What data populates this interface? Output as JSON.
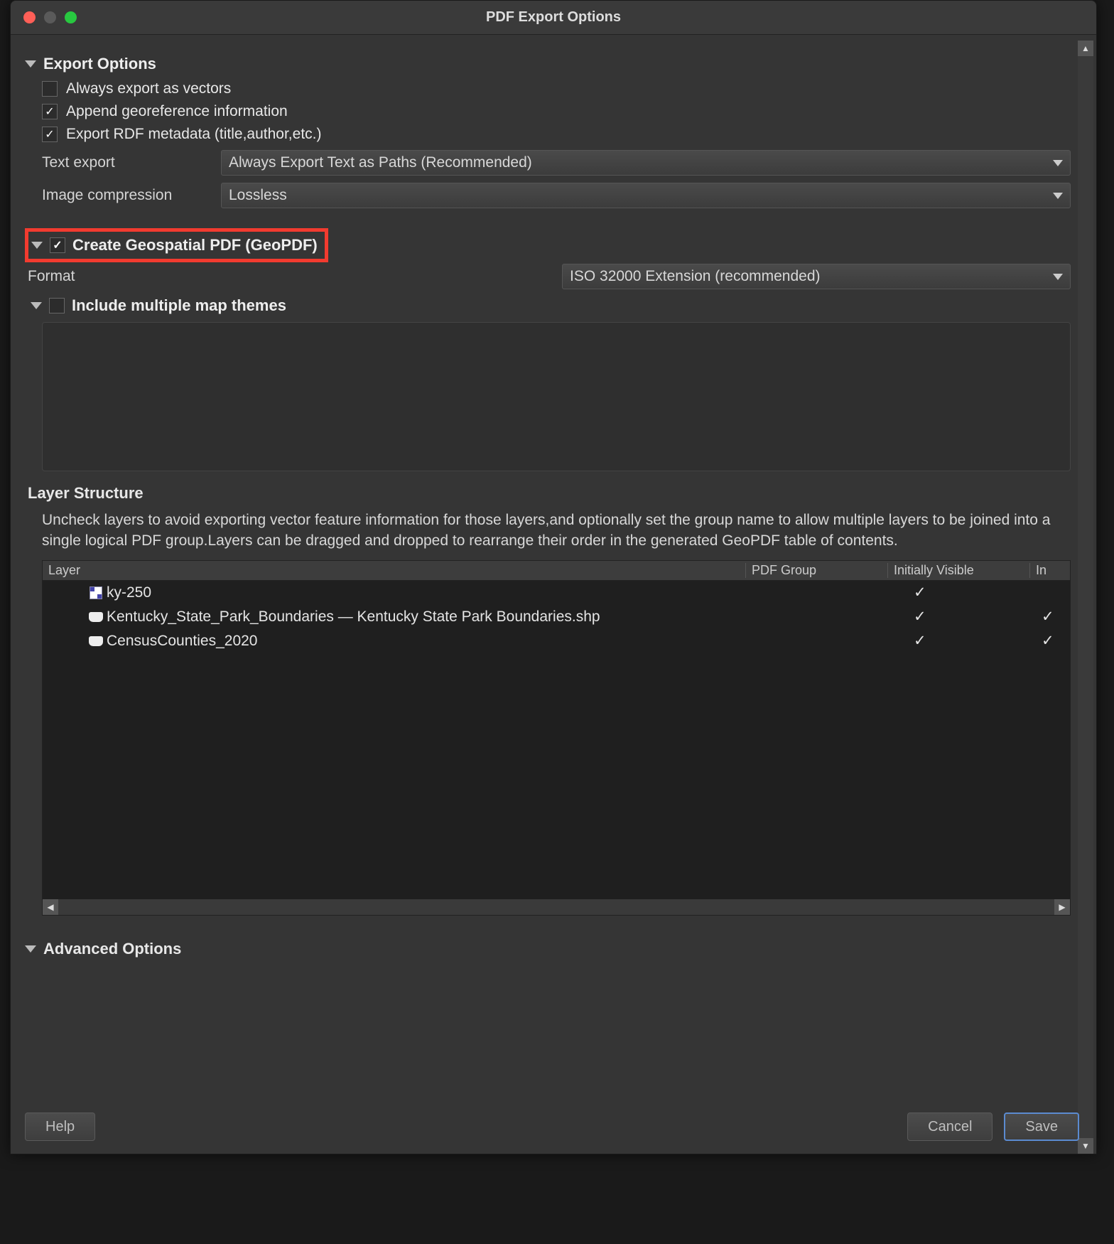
{
  "window": {
    "title": "PDF Export Options"
  },
  "sections": {
    "export_options": {
      "title": "Export Options",
      "always_vectors": {
        "label": "Always export as vectors",
        "checked": false
      },
      "append_georef": {
        "label": "Append georeference information",
        "checked": true
      },
      "export_rdf": {
        "label": "Export RDF metadata (title,author,etc.)",
        "checked": true
      },
      "text_export": {
        "label": "Text export",
        "value": "Always Export Text as Paths (Recommended)"
      },
      "image_compression": {
        "label": "Image compression",
        "value": "Lossless"
      }
    },
    "geopdf": {
      "title": "Create Geospatial PDF (GeoPDF)",
      "checked": true,
      "format": {
        "label": "Format",
        "value": "ISO 32000 Extension (recommended)"
      },
      "include_themes": {
        "label": "Include multiple map themes",
        "checked": false
      }
    },
    "layer_structure": {
      "title": "Layer Structure",
      "description": "Uncheck layers to avoid exporting vector feature information for those layers,and optionally set the group name to allow multiple layers to be joined into a single logical PDF group.Layers can be dragged and dropped to rearrange their order in the generated GeoPDF table of contents.",
      "columns": {
        "layer": "Layer",
        "group": "PDF Group",
        "visible": "Initially Visible",
        "in": "In"
      },
      "rows": [
        {
          "icon": "raster",
          "name": "ky-250",
          "group": "",
          "visible": true,
          "in": false
        },
        {
          "icon": "vector",
          "name": "Kentucky_State_Park_Boundaries — Kentucky State Park Boundaries.shp",
          "group": "",
          "visible": true,
          "in": true
        },
        {
          "icon": "vector",
          "name": "CensusCounties_2020",
          "group": "",
          "visible": true,
          "in": true
        }
      ]
    },
    "advanced": {
      "title": "Advanced Options"
    }
  },
  "footer": {
    "help": "Help",
    "cancel": "Cancel",
    "save": "Save"
  }
}
